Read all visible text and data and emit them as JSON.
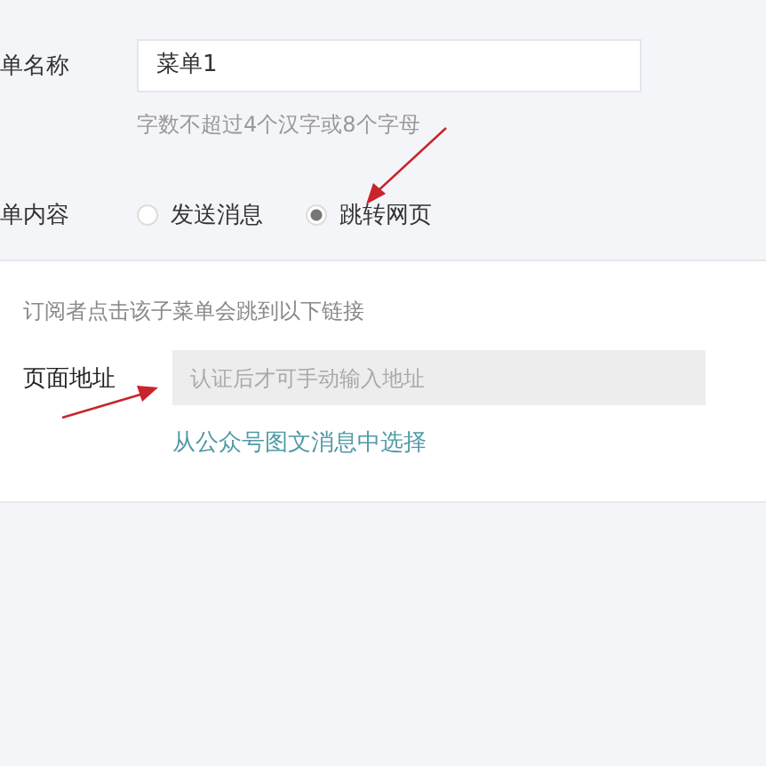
{
  "name_row": {
    "label": "单名称",
    "value": "菜单1",
    "hint": "字数不超过4个汉字或8个字母"
  },
  "content_row": {
    "label": "单内容",
    "options": [
      {
        "label": "发送消息",
        "selected": false
      },
      {
        "label": "跳转网页",
        "selected": true
      }
    ]
  },
  "link_panel": {
    "description": "订阅者点击该子菜单会跳到以下链接",
    "address_label": "页面地址",
    "address_placeholder": "认证后才可手动输入地址",
    "choose_link": "从公众号图文消息中选择"
  }
}
